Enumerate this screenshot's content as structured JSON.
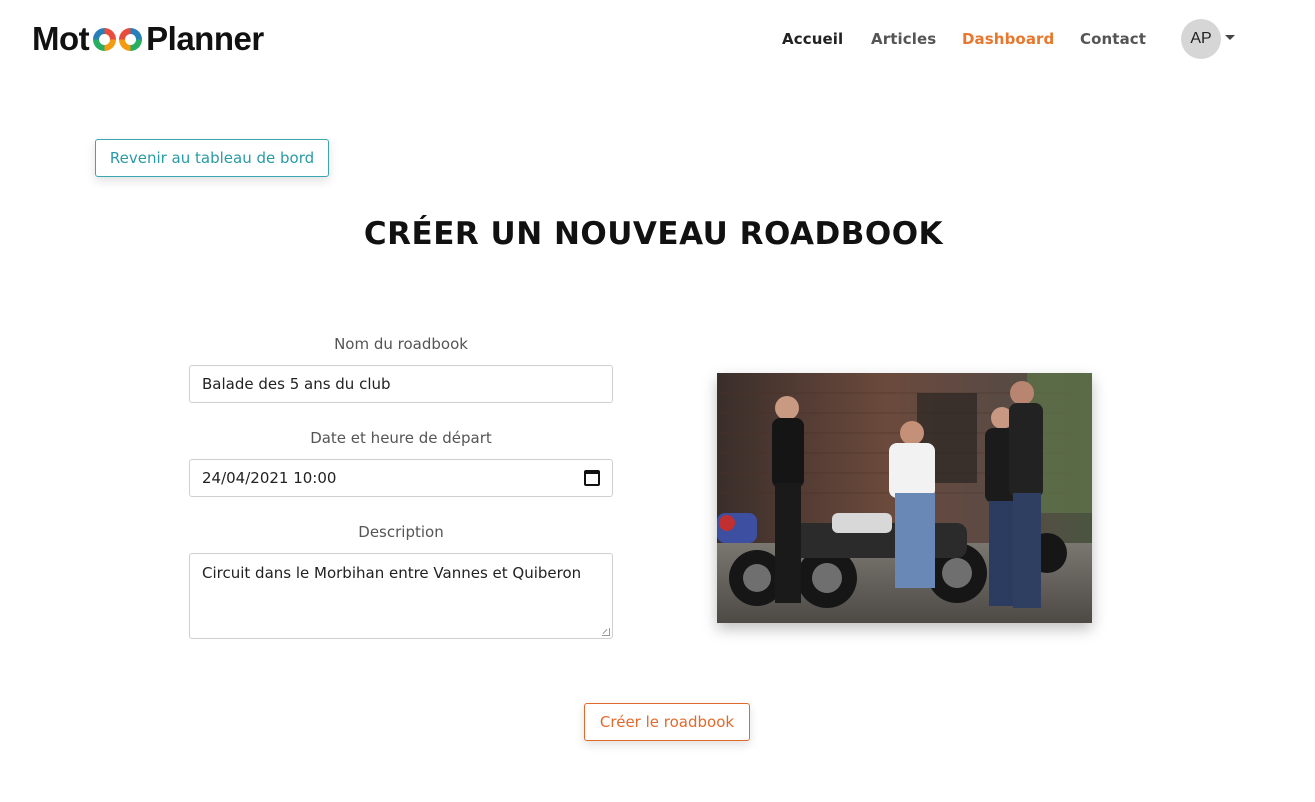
{
  "header": {
    "logo_left": "Mot",
    "logo_right": "Planner",
    "nav": [
      {
        "label": "Accueil"
      },
      {
        "label": "Articles"
      },
      {
        "label": "Dashboard"
      },
      {
        "label": "Contact"
      }
    ],
    "avatar_initials": "AP"
  },
  "back_button": "Revenir au tableau de bord",
  "title": "CRÉER UN NOUVEAU ROADBOOK",
  "form": {
    "name_label": "Nom du roadbook",
    "name_value": "Balade des 5 ans du club",
    "date_label": "Date et heure de départ",
    "date_value": "24/04/2021 10:00",
    "description_label": "Description",
    "description_value": "Circuit dans le Morbihan entre Vannes et Quiberon"
  },
  "submit_button": "Créer le roadbook",
  "colors": {
    "accent": "#e8772e",
    "teal": "#3aa7b0"
  }
}
